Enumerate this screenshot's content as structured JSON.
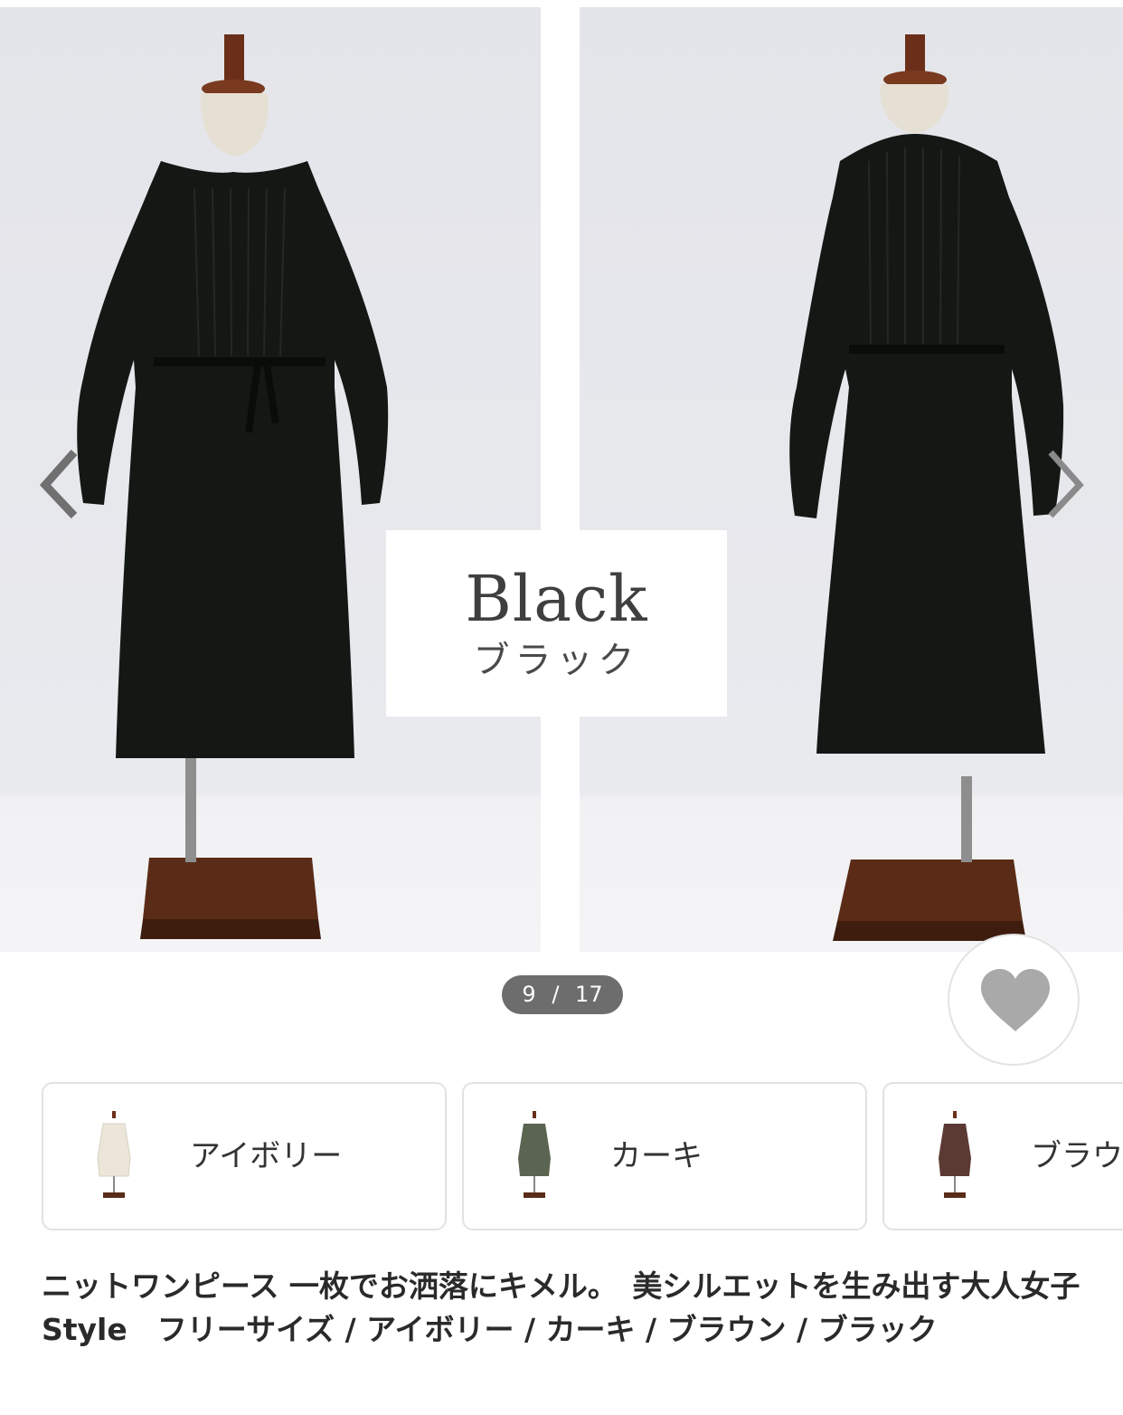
{
  "gallery": {
    "color_card": {
      "name_en": "Black",
      "name_ja": "ブラック"
    },
    "counter": {
      "current": "9",
      "separator": "/",
      "total": "17"
    },
    "dress_color": "#141815"
  },
  "variants": [
    {
      "label": "アイボリー",
      "swatch": "#ece6d9"
    },
    {
      "label": "カーキ",
      "swatch": "#5a6450"
    },
    {
      "label": "ブラウン",
      "swatch": "#5b3a33"
    }
  ],
  "product": {
    "title": "ニットワンピース 一枚でお洒落にキメル。　美シルエットを生み出す大人女子Style　フリーサイズ / アイボリー / カーキ / ブラウン / ブラック"
  }
}
